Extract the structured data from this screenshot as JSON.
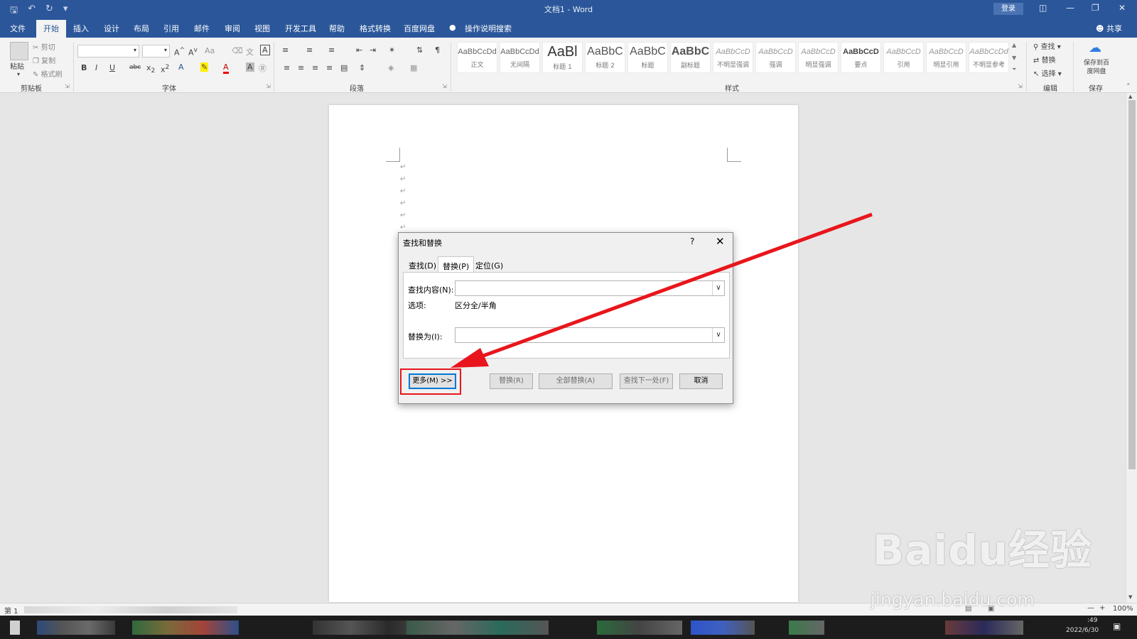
{
  "window": {
    "title": "文档1 - Word",
    "login_label": "登录",
    "share_label": "共享"
  },
  "menu": {
    "tabs": [
      "文件",
      "开始",
      "插入",
      "设计",
      "布局",
      "引用",
      "邮件",
      "审阅",
      "视图",
      "开发工具",
      "帮助",
      "格式转换",
      "百度网盘"
    ],
    "active_tab": "开始",
    "search_label": "操作说明搜索"
  },
  "ribbon": {
    "clipboard": {
      "label": "剪贴板",
      "paste": "粘贴",
      "cut": "剪切",
      "copy": "复制",
      "format_painter": "格式刷"
    },
    "font": {
      "label": "字体"
    },
    "paragraph": {
      "label": "段落"
    },
    "styles": {
      "label": "样式",
      "items": [
        {
          "preview": "AaBbCcDd",
          "name": "正文"
        },
        {
          "preview": "AaBbCcDd",
          "name": "无间隔"
        },
        {
          "preview": "AaBl",
          "name": "标题 1"
        },
        {
          "preview": "AaBbC",
          "name": "标题 2"
        },
        {
          "preview": "AaBbC",
          "name": "标题"
        },
        {
          "preview": "AaBbC",
          "name": "副标题"
        },
        {
          "preview": "AaBbCcD",
          "name": "不明显强调"
        },
        {
          "preview": "AaBbCcD",
          "name": "强调"
        },
        {
          "preview": "AaBbCcD",
          "name": "明显强调"
        },
        {
          "preview": "AaBbCcD",
          "name": "要点"
        },
        {
          "preview": "AaBbCcD",
          "name": "引用"
        },
        {
          "preview": "AaBbCcD",
          "name": "明显引用"
        },
        {
          "preview": "AaBbCcDd",
          "name": "不明显参考"
        }
      ]
    },
    "editing": {
      "label": "编辑",
      "find": "查找",
      "replace": "替换",
      "select": "选择"
    },
    "save": {
      "label": "保存",
      "button": "保存到百度网盘"
    }
  },
  "dialog": {
    "title": "查找和替换",
    "help": "?",
    "close": "✕",
    "tabs": [
      "查找(D)",
      "替换(P)",
      "定位(G)"
    ],
    "active_tab": "替换(P)",
    "find_label": "查找内容(N):",
    "find_value": "",
    "options_label": "选项:",
    "options_value": "区分全/半角",
    "replace_label": "替换为(I):",
    "replace_value": "",
    "buttons": {
      "more": "更多(M) >>",
      "replace": "替换(R)",
      "replace_all": "全部替换(A)",
      "find_next": "查找下一处(F)",
      "cancel": "取消"
    }
  },
  "status": {
    "page": "第 1",
    "zoom": "100%"
  },
  "taskbar": {
    "clock_time": ":49",
    "clock_date": "2022/6/30"
  },
  "watermark": {
    "brand": "Baidu经验",
    "url": "jingyan.baidu.com"
  },
  "colors": {
    "word_blue": "#2b579a",
    "annotation_red": "#e8161c"
  }
}
